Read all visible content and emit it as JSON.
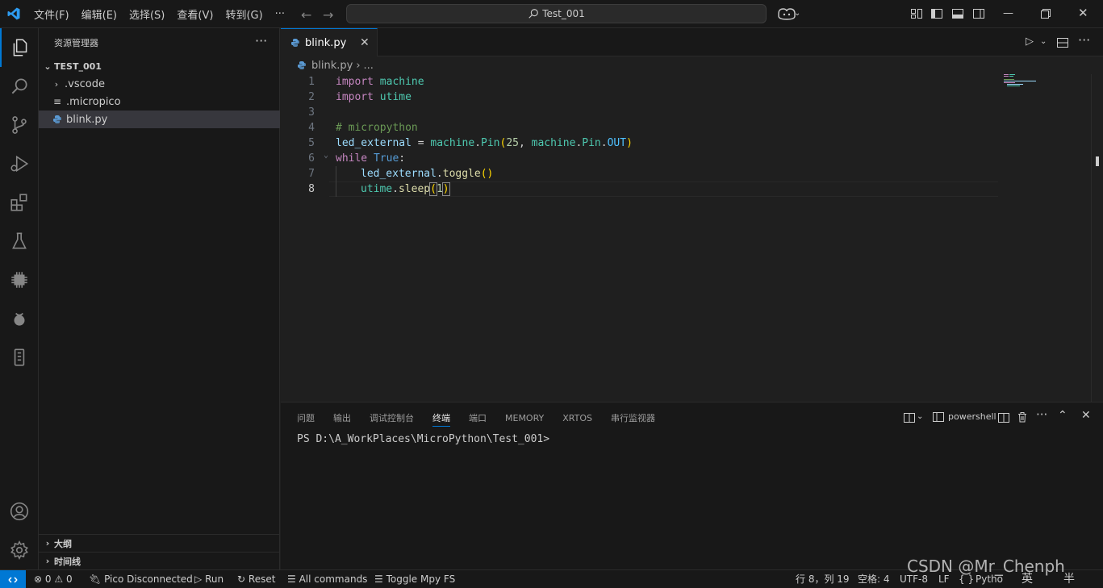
{
  "titlebar": {
    "menu": [
      "文件(F)",
      "编辑(E)",
      "选择(S)",
      "查看(V)",
      "转到(G)",
      "···"
    ],
    "search": "Test_001"
  },
  "sidebar": {
    "title": "资源管理器",
    "more": "···",
    "folder": "TEST_001",
    "items": [
      {
        "label": ".vscode",
        "type": "folder"
      },
      {
        "label": ".micropico",
        "type": "file"
      },
      {
        "label": "blink.py",
        "type": "python"
      }
    ],
    "outline": "大纲",
    "timeline": "时间线"
  },
  "editor": {
    "tab_label": "blink.py",
    "breadcrumb_file": "blink.py",
    "breadcrumb_rest": "...",
    "line_numbers": [
      "1",
      "2",
      "3",
      "4",
      "5",
      "6",
      "7",
      "8"
    ],
    "code": {
      "l1_kw": "import",
      "l1_mod": "machine",
      "l2_kw": "import",
      "l2_mod": "utime",
      "l4": "# micropython",
      "l5_var": "led_external",
      "l5_eq": " = ",
      "l5_mod": "machine",
      "l5_dot1": ".",
      "l5_fn": "Pin",
      "l5_open": "(",
      "l5_num": "25",
      "l5_comma": ", ",
      "l5_mod2": "machine",
      "l5_dot2": ".",
      "l5_cls": "Pin",
      "l5_dot3": ".",
      "l5_cst": "OUT",
      "l5_close": ")",
      "l6_kw": "while",
      "l6_true": "True",
      "l6_colon": ":",
      "l7_var": "led_external",
      "l7_dot": ".",
      "l7_fn": "toggle",
      "l7_paren": "()",
      "l8_mod": "utime",
      "l8_dot": ".",
      "l8_fn": "sleep",
      "l8_open": "(",
      "l8_num": "1",
      "l8_close": ")"
    }
  },
  "panel": {
    "tabs": [
      "问题",
      "输出",
      "调试控制台",
      "终端",
      "端口",
      "MEMORY",
      "XRTOS",
      "串行监视器"
    ],
    "active_tab": "终端",
    "shell": "powershell",
    "prompt": "PS D:\\A_WorkPlaces\\MicroPython\\Test_001>"
  },
  "statusbar": {
    "problems": "0",
    "warnings": "0",
    "pico": "Pico Disconnected",
    "run": "Run",
    "reset": "Reset",
    "all_commands": "All commands",
    "toggle_fs": "Toggle Mpy FS",
    "position": "行 8，列 19",
    "spaces": "空格: 4",
    "encoding": "UTF-8",
    "eol": "LF",
    "braces": "{ }",
    "language": "Pytho",
    "ime": "英",
    "ime2": "半"
  },
  "watermark": "CSDN @Mr_Chenph",
  "colors": {
    "accent": "#0078d4",
    "background": "#1f1f1f",
    "sidebar": "#181818"
  }
}
